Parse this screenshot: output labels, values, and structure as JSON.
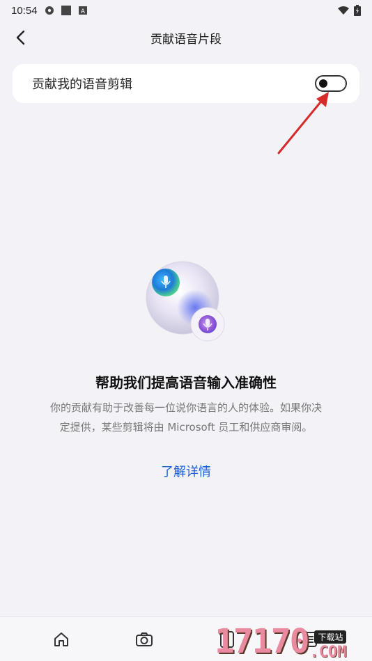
{
  "status_bar": {
    "time": "10:54",
    "icons": [
      "photos-icon",
      "square-icon",
      "a-letter-icon",
      "wifi-icon",
      "battery-icon"
    ]
  },
  "header": {
    "title": "贡献语音片段",
    "back_icon": "chevron-left-icon"
  },
  "toggle": {
    "label": "贡献我的语音剪辑",
    "state": "off"
  },
  "annotation": {
    "type": "red-arrow",
    "color": "#d62b2b"
  },
  "info": {
    "illustration": "voice-bubbles-icon",
    "title": "帮助我们提高语音输入准确性",
    "description_line1": "你的贡献有助于改善每一位说你语言的人的体验。如果你决",
    "description_line2": "定提供，某些剪辑将由 Microsoft 员工和供应商审阅。",
    "link": "了解详情"
  },
  "bottom_nav": {
    "items": [
      "home-icon",
      "camera-icon",
      "tabs-icon",
      "apps-icon"
    ],
    "tab_count": "0"
  },
  "watermark": {
    "digits": "17170",
    "badge": "下载站",
    "suffix": ".COM"
  },
  "colors": {
    "background": "#f3f3f7",
    "card": "#ffffff",
    "link": "#1a5fd6",
    "arrow": "#d62b2b"
  }
}
